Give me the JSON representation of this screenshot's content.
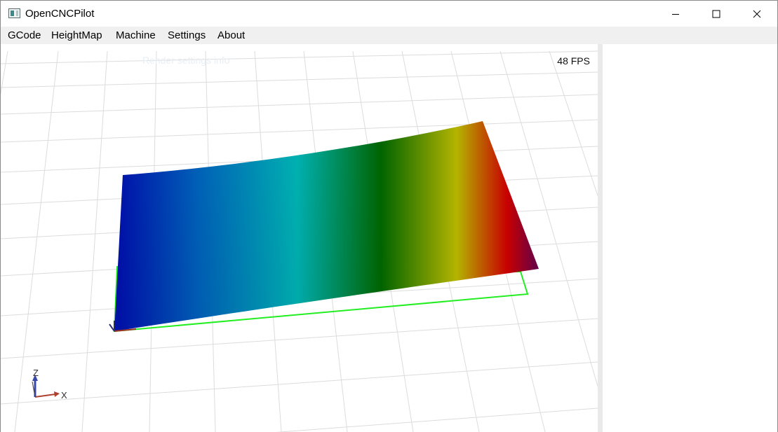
{
  "window": {
    "title": "OpenCNCPilot"
  },
  "menubar": {
    "items": [
      "GCode",
      "HeightMap",
      "Machine",
      "Settings",
      "About"
    ]
  },
  "viewport": {
    "fps_label": "48 FPS",
    "ghost_label": "Render settings info",
    "axis_x_label": "X",
    "axis_z_label": "Z",
    "boundary_color": "#22ee22",
    "heightmap_gradient": [
      "#0014b4",
      "#0064c0",
      "#00b4b4",
      "#006400",
      "#b4b400",
      "#c80000",
      "#5a0050"
    ]
  },
  "icons": {
    "app": "app-icon",
    "minimize": "minimize-icon",
    "maximize": "maximize-icon",
    "close": "close-icon"
  }
}
